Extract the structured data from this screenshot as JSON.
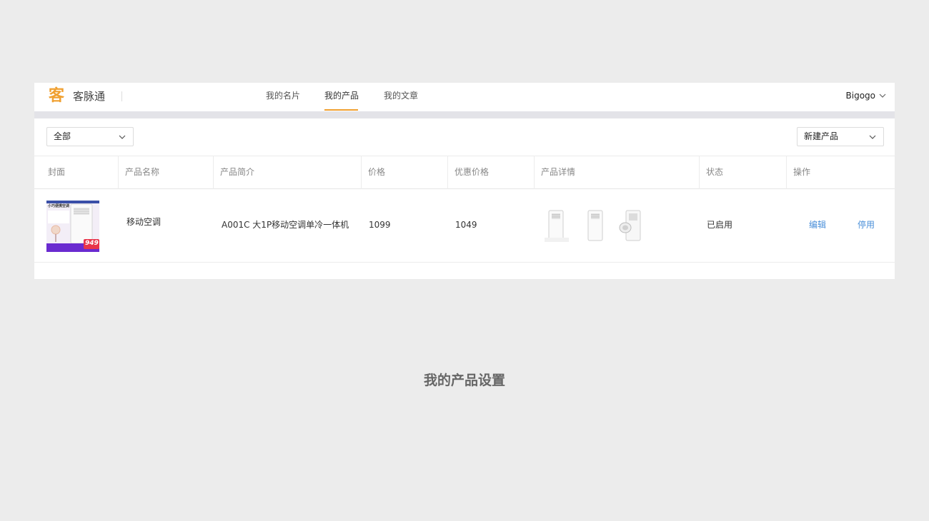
{
  "header": {
    "logo_glyph": "客",
    "app_name": "客脉通",
    "nav": [
      {
        "label": "我的名片"
      },
      {
        "label": "我的产品"
      },
      {
        "label": "我的文章"
      }
    ],
    "active_nav": "我的产品",
    "user": "Bigogo",
    "accent_color": "#f0a030"
  },
  "filters": {
    "category_value": "全部",
    "new_product_label": "新建产品"
  },
  "table": {
    "columns": [
      "封面",
      "产品名称",
      "产品简介",
      "价格",
      "优惠价格",
      "产品详情",
      "状态",
      "操作"
    ],
    "rows": [
      {
        "cover": {
          "headline": "小巧便携空调",
          "price_badge": "949"
        },
        "name": "移动空调",
        "summary": "A001C 大1P移动空调单冷一体机",
        "price": "1099",
        "discount_price": "1049",
        "status": "已启用",
        "actions": {
          "edit": "编辑",
          "disable": "停用"
        }
      }
    ]
  },
  "caption": "我的产品设置"
}
